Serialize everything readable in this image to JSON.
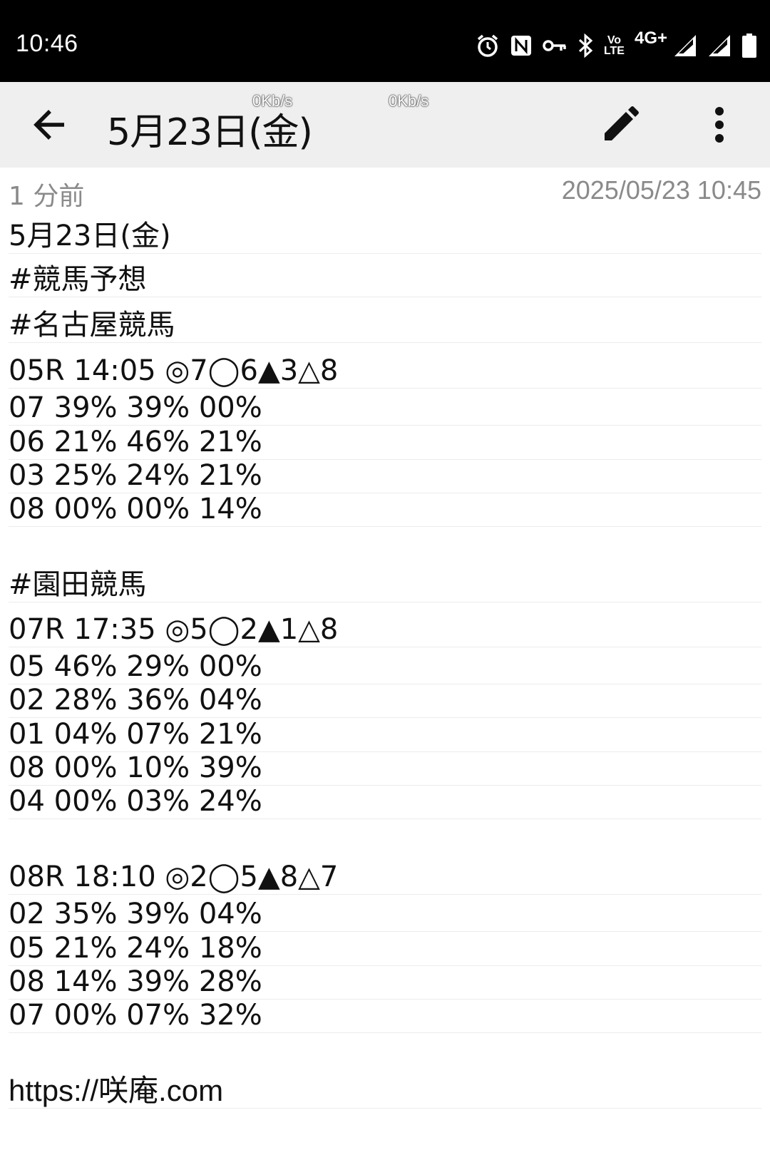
{
  "status_bar": {
    "time": "10:46",
    "icons": [
      "alarm-icon",
      "nfc-icon",
      "vpn-key-icon",
      "bluetooth-icon",
      "volte-icon",
      "4g-icon",
      "signal-icon",
      "signal-icon",
      "battery-icon"
    ],
    "volte_top": "Vo",
    "volte_bottom": "LTE",
    "network": "4G+"
  },
  "app_bar": {
    "title": "5月23日(金)",
    "speed_1": "0Kb/s",
    "speed_2": "0Kb/s",
    "back_icon": "arrow-back-icon",
    "edit_icon": "pencil-icon",
    "menu_icon": "more-vertical-icon"
  },
  "meta": {
    "relative_time": "1 分前",
    "timestamp": "2025/05/23 10:45"
  },
  "note": {
    "lines": [
      "5月23日(金)",
      "#競馬予想",
      "#名古屋競馬",
      "05R 14:05 ◎7◯6▲3△8",
      "07 39% 39% 00%",
      "06 21% 46% 21%",
      "03 25% 24% 21%",
      "08 00% 00% 14%",
      "",
      "#園田競馬",
      "07R 17:35 ◎5◯2▲1△8",
      "05 46% 29% 00%",
      "02 28% 36% 04%",
      "01 04% 07% 21%",
      "08 00% 10% 39%",
      "04 00% 03% 24%",
      "",
      "08R 18:10 ◎2◯5▲8△7",
      "02 35% 39% 04%",
      "05 21% 24% 18%",
      "08 14% 39% 28%",
      "07 00% 07% 32%",
      "",
      "https://咲庵.com"
    ]
  }
}
